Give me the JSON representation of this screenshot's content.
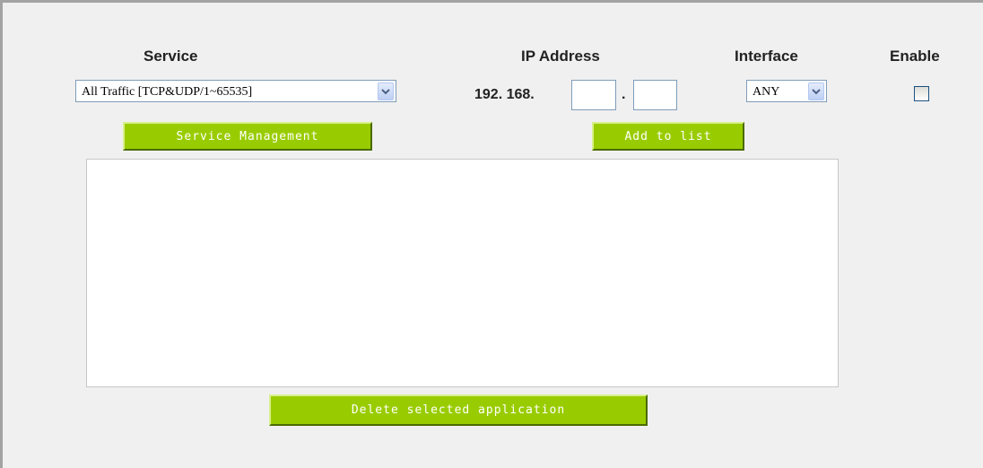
{
  "headers": {
    "service": "Service",
    "ip_address": "IP Address",
    "interface": "Interface",
    "enable": "Enable"
  },
  "service_select": {
    "value": "All Traffic [TCP&UDP/1~65535]"
  },
  "ip": {
    "prefix_a": "192. 168.",
    "separator": ".",
    "octet3": "",
    "octet4": ""
  },
  "interface_select": {
    "value": "ANY"
  },
  "enable": {
    "checked": false
  },
  "buttons": {
    "service_management": "Service Management",
    "add_to_list": "Add to list",
    "delete_selected": "Delete selected application"
  },
  "colors": {
    "button_green": "#99cc00",
    "panel_bg": "#f0f0f0"
  },
  "icons": {
    "dropdown": "chevron-down-icon"
  }
}
